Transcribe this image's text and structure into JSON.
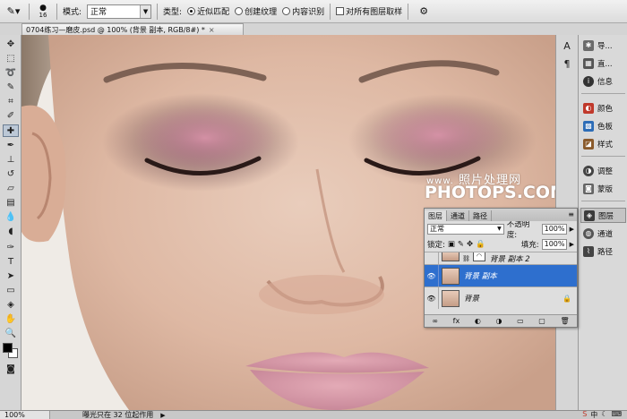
{
  "options_bar": {
    "brush_size": "16",
    "mode_label": "模式:",
    "mode_value": "正常",
    "type_label": "类型:",
    "type_options": [
      "近似匹配",
      "创建纹理",
      "内容识别"
    ],
    "type_selected": 0,
    "sample_all_label": "对所有图层取样"
  },
  "document": {
    "tab_title": "0704练习—磨皮.psd @ 100% (背景 副本, RGB/8#) *",
    "close": "×"
  },
  "watermark": {
    "site_cn": "照片处理网",
    "site_en": "PHOTOPS.COM",
    "prefix": "www."
  },
  "right_strip": {
    "icons": [
      "A",
      "¶"
    ]
  },
  "dock": {
    "items": [
      {
        "label": "导...",
        "icon": "navigator-icon",
        "color": "#6b6b6b"
      },
      {
        "label": "直...",
        "icon": "histogram-icon",
        "color": "#555555"
      },
      {
        "label": "信息",
        "icon": "info-icon",
        "color": "#333333"
      },
      {
        "label": "颜色",
        "icon": "color-icon",
        "color": "#c0392b"
      },
      {
        "label": "色板",
        "icon": "swatches-icon",
        "color": "#2c6cb7"
      },
      {
        "label": "样式",
        "icon": "styles-icon",
        "color": "#8a5a2b"
      },
      {
        "label": "调整",
        "icon": "adjustments-icon",
        "color": "#444444"
      },
      {
        "label": "蒙版",
        "icon": "masks-icon",
        "color": "#666666"
      },
      {
        "label": "图层",
        "icon": "layers-icon",
        "color": "#3b3b3b"
      },
      {
        "label": "通道",
        "icon": "channels-icon",
        "color": "#555555"
      },
      {
        "label": "路径",
        "icon": "paths-icon",
        "color": "#444444"
      }
    ],
    "active_index": 8
  },
  "layers_panel": {
    "tabs": [
      "图层",
      "通道",
      "路径"
    ],
    "blend_mode": "正常",
    "opacity_label": "不透明度:",
    "opacity_value": "100%",
    "lock_label": "锁定:",
    "fill_label": "填充:",
    "fill_value": "100%",
    "layers": [
      {
        "name": "背景 副本 2",
        "selected": false,
        "visible": false
      },
      {
        "name": "背景 副本",
        "selected": true,
        "visible": true
      },
      {
        "name": "背景",
        "selected": false,
        "visible": true
      }
    ],
    "bottom_icons": [
      "∞",
      "fx",
      "◐",
      "◑",
      "▭",
      "▢",
      "🗑"
    ],
    "menu_glyph": "≡"
  },
  "status_bar": {
    "zoom": "100%",
    "info": "曝光只在 32 位起作用"
  },
  "colors": {
    "selection_blue": "#2e6fce",
    "panel_gray": "#dedede"
  }
}
